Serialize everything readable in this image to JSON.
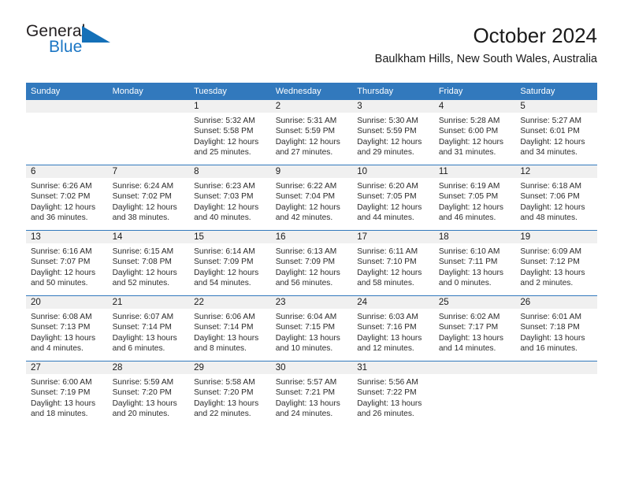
{
  "branding": {
    "name_part1": "General",
    "name_part2": "Blue",
    "triangle_color": "#1470b8",
    "blue_color": "#1b76c4"
  },
  "header": {
    "title": "October 2024",
    "subtitle": "Baulkham Hills, New South Wales, Australia",
    "header_bg_color": "#3279bd",
    "daynum_bg_color": "#f0f0f0"
  },
  "weekday_headers": [
    "Sunday",
    "Monday",
    "Tuesday",
    "Wednesday",
    "Thursday",
    "Friday",
    "Saturday"
  ],
  "labels": {
    "sunrise_prefix": "Sunrise:",
    "sunset_prefix": "Sunset:",
    "daylight_prefix": "Daylight:"
  },
  "weeks": [
    [
      {
        "day": "",
        "empty": true,
        "sunrise": "",
        "sunset": "",
        "daylight_line1": "",
        "daylight_line2": ""
      },
      {
        "day": "",
        "empty": true,
        "sunrise": "",
        "sunset": "",
        "daylight_line1": "",
        "daylight_line2": ""
      },
      {
        "day": "1",
        "empty": false,
        "sunrise": "Sunrise: 5:32 AM",
        "sunset": "Sunset: 5:58 PM",
        "daylight_line1": "Daylight: 12 hours",
        "daylight_line2": "and 25 minutes."
      },
      {
        "day": "2",
        "empty": false,
        "sunrise": "Sunrise: 5:31 AM",
        "sunset": "Sunset: 5:59 PM",
        "daylight_line1": "Daylight: 12 hours",
        "daylight_line2": "and 27 minutes."
      },
      {
        "day": "3",
        "empty": false,
        "sunrise": "Sunrise: 5:30 AM",
        "sunset": "Sunset: 5:59 PM",
        "daylight_line1": "Daylight: 12 hours",
        "daylight_line2": "and 29 minutes."
      },
      {
        "day": "4",
        "empty": false,
        "sunrise": "Sunrise: 5:28 AM",
        "sunset": "Sunset: 6:00 PM",
        "daylight_line1": "Daylight: 12 hours",
        "daylight_line2": "and 31 minutes."
      },
      {
        "day": "5",
        "empty": false,
        "sunrise": "Sunrise: 5:27 AM",
        "sunset": "Sunset: 6:01 PM",
        "daylight_line1": "Daylight: 12 hours",
        "daylight_line2": "and 34 minutes."
      }
    ],
    [
      {
        "day": "6",
        "empty": false,
        "sunrise": "Sunrise: 6:26 AM",
        "sunset": "Sunset: 7:02 PM",
        "daylight_line1": "Daylight: 12 hours",
        "daylight_line2": "and 36 minutes."
      },
      {
        "day": "7",
        "empty": false,
        "sunrise": "Sunrise: 6:24 AM",
        "sunset": "Sunset: 7:02 PM",
        "daylight_line1": "Daylight: 12 hours",
        "daylight_line2": "and 38 minutes."
      },
      {
        "day": "8",
        "empty": false,
        "sunrise": "Sunrise: 6:23 AM",
        "sunset": "Sunset: 7:03 PM",
        "daylight_line1": "Daylight: 12 hours",
        "daylight_line2": "and 40 minutes."
      },
      {
        "day": "9",
        "empty": false,
        "sunrise": "Sunrise: 6:22 AM",
        "sunset": "Sunset: 7:04 PM",
        "daylight_line1": "Daylight: 12 hours",
        "daylight_line2": "and 42 minutes."
      },
      {
        "day": "10",
        "empty": false,
        "sunrise": "Sunrise: 6:20 AM",
        "sunset": "Sunset: 7:05 PM",
        "daylight_line1": "Daylight: 12 hours",
        "daylight_line2": "and 44 minutes."
      },
      {
        "day": "11",
        "empty": false,
        "sunrise": "Sunrise: 6:19 AM",
        "sunset": "Sunset: 7:05 PM",
        "daylight_line1": "Daylight: 12 hours",
        "daylight_line2": "and 46 minutes."
      },
      {
        "day": "12",
        "empty": false,
        "sunrise": "Sunrise: 6:18 AM",
        "sunset": "Sunset: 7:06 PM",
        "daylight_line1": "Daylight: 12 hours",
        "daylight_line2": "and 48 minutes."
      }
    ],
    [
      {
        "day": "13",
        "empty": false,
        "sunrise": "Sunrise: 6:16 AM",
        "sunset": "Sunset: 7:07 PM",
        "daylight_line1": "Daylight: 12 hours",
        "daylight_line2": "and 50 minutes."
      },
      {
        "day": "14",
        "empty": false,
        "sunrise": "Sunrise: 6:15 AM",
        "sunset": "Sunset: 7:08 PM",
        "daylight_line1": "Daylight: 12 hours",
        "daylight_line2": "and 52 minutes."
      },
      {
        "day": "15",
        "empty": false,
        "sunrise": "Sunrise: 6:14 AM",
        "sunset": "Sunset: 7:09 PM",
        "daylight_line1": "Daylight: 12 hours",
        "daylight_line2": "and 54 minutes."
      },
      {
        "day": "16",
        "empty": false,
        "sunrise": "Sunrise: 6:13 AM",
        "sunset": "Sunset: 7:09 PM",
        "daylight_line1": "Daylight: 12 hours",
        "daylight_line2": "and 56 minutes."
      },
      {
        "day": "17",
        "empty": false,
        "sunrise": "Sunrise: 6:11 AM",
        "sunset": "Sunset: 7:10 PM",
        "daylight_line1": "Daylight: 12 hours",
        "daylight_line2": "and 58 minutes."
      },
      {
        "day": "18",
        "empty": false,
        "sunrise": "Sunrise: 6:10 AM",
        "sunset": "Sunset: 7:11 PM",
        "daylight_line1": "Daylight: 13 hours",
        "daylight_line2": "and 0 minutes."
      },
      {
        "day": "19",
        "empty": false,
        "sunrise": "Sunrise: 6:09 AM",
        "sunset": "Sunset: 7:12 PM",
        "daylight_line1": "Daylight: 13 hours",
        "daylight_line2": "and 2 minutes."
      }
    ],
    [
      {
        "day": "20",
        "empty": false,
        "sunrise": "Sunrise: 6:08 AM",
        "sunset": "Sunset: 7:13 PM",
        "daylight_line1": "Daylight: 13 hours",
        "daylight_line2": "and 4 minutes."
      },
      {
        "day": "21",
        "empty": false,
        "sunrise": "Sunrise: 6:07 AM",
        "sunset": "Sunset: 7:14 PM",
        "daylight_line1": "Daylight: 13 hours",
        "daylight_line2": "and 6 minutes."
      },
      {
        "day": "22",
        "empty": false,
        "sunrise": "Sunrise: 6:06 AM",
        "sunset": "Sunset: 7:14 PM",
        "daylight_line1": "Daylight: 13 hours",
        "daylight_line2": "and 8 minutes."
      },
      {
        "day": "23",
        "empty": false,
        "sunrise": "Sunrise: 6:04 AM",
        "sunset": "Sunset: 7:15 PM",
        "daylight_line1": "Daylight: 13 hours",
        "daylight_line2": "and 10 minutes."
      },
      {
        "day": "24",
        "empty": false,
        "sunrise": "Sunrise: 6:03 AM",
        "sunset": "Sunset: 7:16 PM",
        "daylight_line1": "Daylight: 13 hours",
        "daylight_line2": "and 12 minutes."
      },
      {
        "day": "25",
        "empty": false,
        "sunrise": "Sunrise: 6:02 AM",
        "sunset": "Sunset: 7:17 PM",
        "daylight_line1": "Daylight: 13 hours",
        "daylight_line2": "and 14 minutes."
      },
      {
        "day": "26",
        "empty": false,
        "sunrise": "Sunrise: 6:01 AM",
        "sunset": "Sunset: 7:18 PM",
        "daylight_line1": "Daylight: 13 hours",
        "daylight_line2": "and 16 minutes."
      }
    ],
    [
      {
        "day": "27",
        "empty": false,
        "sunrise": "Sunrise: 6:00 AM",
        "sunset": "Sunset: 7:19 PM",
        "daylight_line1": "Daylight: 13 hours",
        "daylight_line2": "and 18 minutes."
      },
      {
        "day": "28",
        "empty": false,
        "sunrise": "Sunrise: 5:59 AM",
        "sunset": "Sunset: 7:20 PM",
        "daylight_line1": "Daylight: 13 hours",
        "daylight_line2": "and 20 minutes."
      },
      {
        "day": "29",
        "empty": false,
        "sunrise": "Sunrise: 5:58 AM",
        "sunset": "Sunset: 7:20 PM",
        "daylight_line1": "Daylight: 13 hours",
        "daylight_line2": "and 22 minutes."
      },
      {
        "day": "30",
        "empty": false,
        "sunrise": "Sunrise: 5:57 AM",
        "sunset": "Sunset: 7:21 PM",
        "daylight_line1": "Daylight: 13 hours",
        "daylight_line2": "and 24 minutes."
      },
      {
        "day": "31",
        "empty": false,
        "sunrise": "Sunrise: 5:56 AM",
        "sunset": "Sunset: 7:22 PM",
        "daylight_line1": "Daylight: 13 hours",
        "daylight_line2": "and 26 minutes."
      },
      {
        "day": "",
        "empty": true,
        "sunrise": "",
        "sunset": "",
        "daylight_line1": "",
        "daylight_line2": ""
      },
      {
        "day": "",
        "empty": true,
        "sunrise": "",
        "sunset": "",
        "daylight_line1": "",
        "daylight_line2": ""
      }
    ]
  ]
}
